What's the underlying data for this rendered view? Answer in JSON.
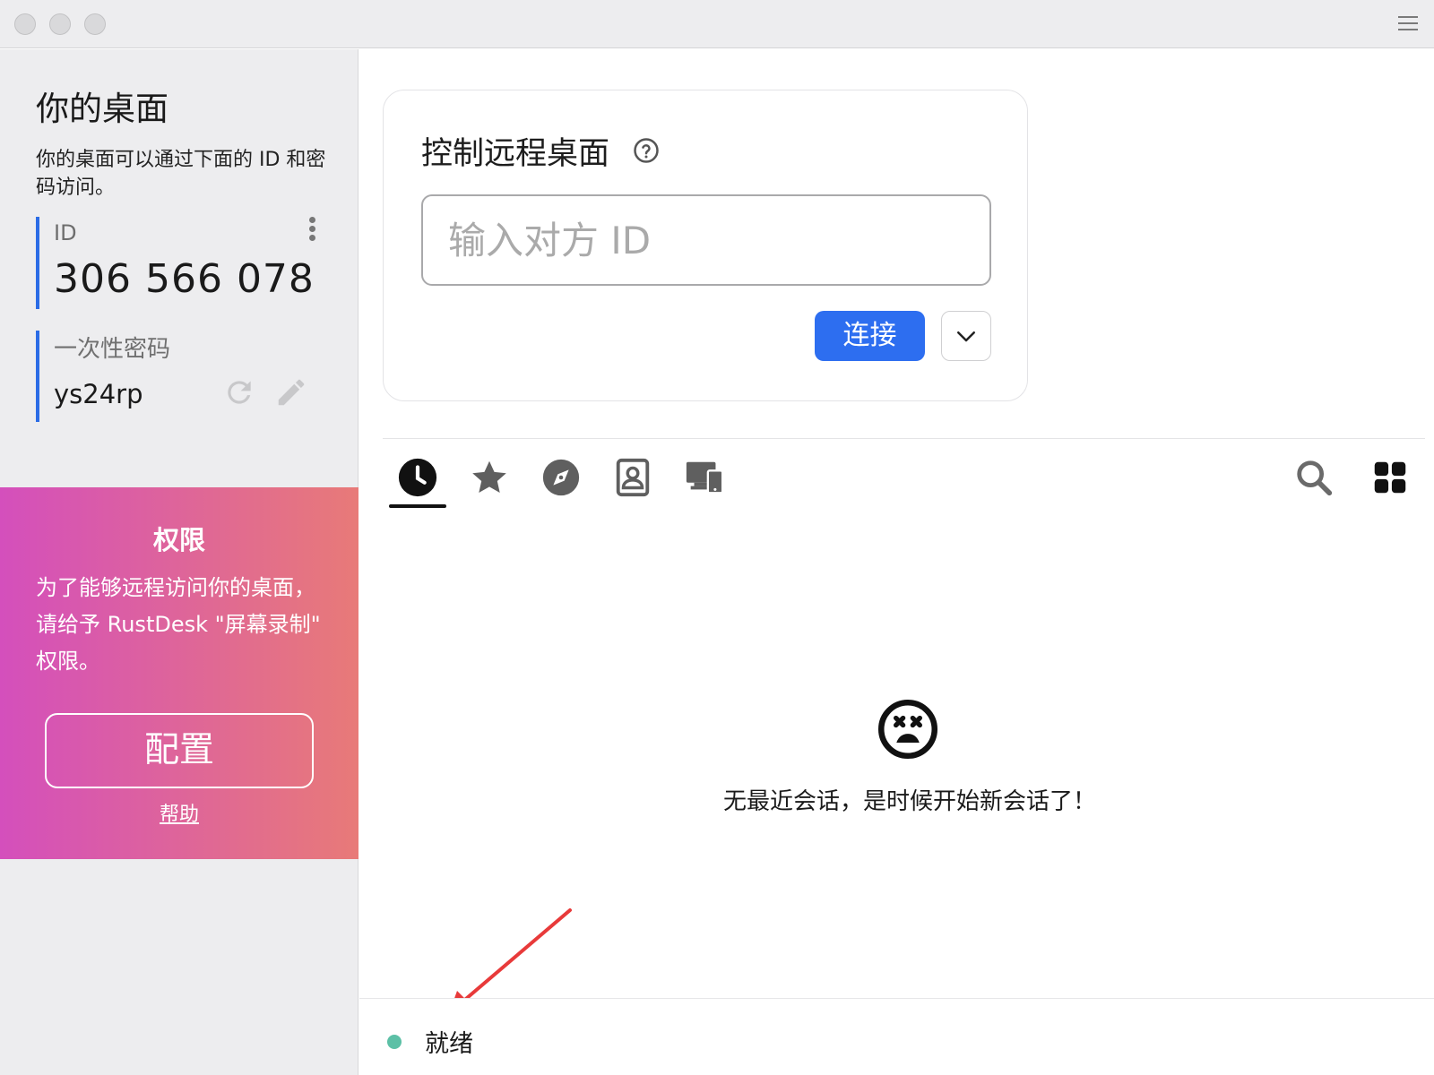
{
  "left_panel": {
    "title": "你的桌面",
    "description": "你的桌面可以通过下面的 ID 和密码访问。",
    "id_label": "ID",
    "id_value": "306 566 078",
    "password_label": "一次性密码",
    "password_value": "ys24rp"
  },
  "permission": {
    "title": "权限",
    "text": "为了能够远程访问你的桌面，请给予 RustDesk \"屏幕录制\" 权限。",
    "configure_label": "配置",
    "help_label": "帮助"
  },
  "remote_card": {
    "title": "控制远程桌面",
    "id_placeholder": "输入对方 ID",
    "connect_label": "连接"
  },
  "tabs": [
    {
      "name": "recent",
      "icon": "clock-icon",
      "active": true
    },
    {
      "name": "favorites",
      "icon": "star-icon"
    },
    {
      "name": "discovered",
      "icon": "compass-icon"
    },
    {
      "name": "address-book",
      "icon": "contact-book-icon"
    },
    {
      "name": "devices",
      "icon": "devices-icon"
    }
  ],
  "empty_state": {
    "icon": "sad-face-icon",
    "message": "无最近会话，是时候开始新会话了！"
  },
  "status": {
    "text": "就绪",
    "dot_color": "#5cc0a6"
  },
  "colors": {
    "accent": "#2d6ef0",
    "permission_gradient_start": "#d44fbc",
    "permission_gradient_end": "#e87a78",
    "annotation_arrow": "#e83a3a"
  }
}
